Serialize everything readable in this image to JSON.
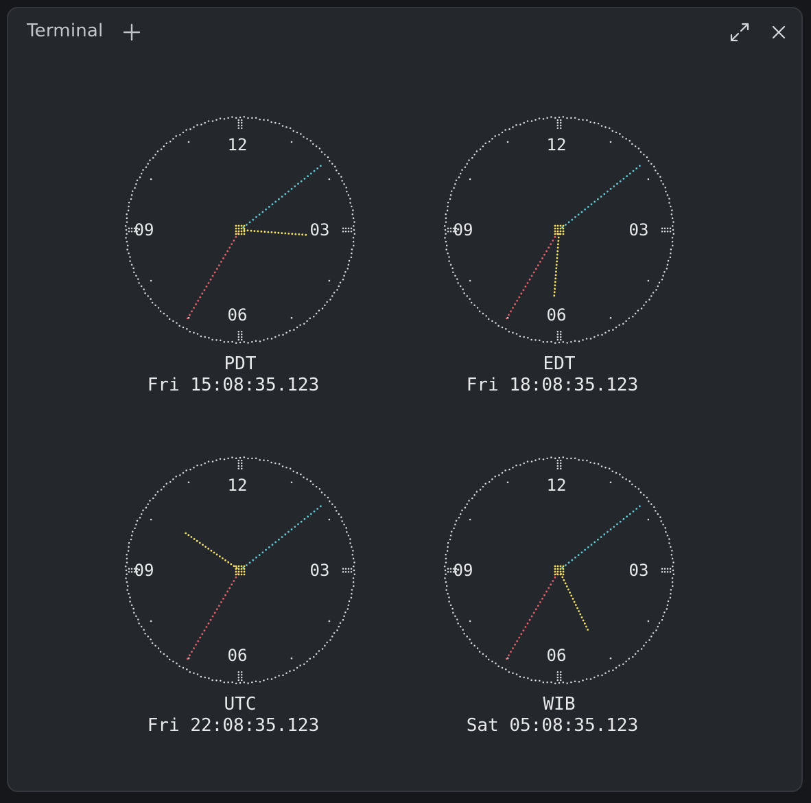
{
  "window": {
    "title": "Terminal",
    "add_icon": "plus-icon",
    "expand_icon": "expand-icon",
    "close_icon": "close-icon"
  },
  "colors": {
    "dial": "#d7d9dc",
    "hour_hand": "#f2e26a",
    "minute_hand": "#62c6d0",
    "second_hand": "#e0616a",
    "text": "#e7e8ea"
  },
  "numerals": {
    "n12": "12",
    "n3": "03",
    "n6": "06",
    "n9": "09"
  },
  "clocks": [
    {
      "zone": "PDT",
      "datetime": "Fri 15:08:35.123",
      "hour": 15,
      "minute": 8,
      "second": 35.123
    },
    {
      "zone": "EDT",
      "datetime": "Fri 18:08:35.123",
      "hour": 18,
      "minute": 8,
      "second": 35.123
    },
    {
      "zone": "UTC",
      "datetime": "Fri 22:08:35.123",
      "hour": 22,
      "minute": 8,
      "second": 35.123
    },
    {
      "zone": "WIB",
      "datetime": "Sat 05:08:35.123",
      "hour": 5,
      "minute": 8,
      "second": 35.123
    }
  ]
}
